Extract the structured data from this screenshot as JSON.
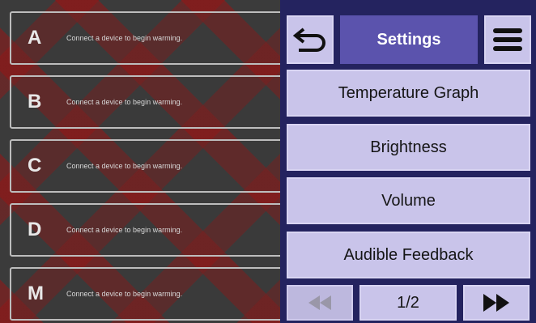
{
  "devices": [
    {
      "letter": "A",
      "message": "Connect a device to begin warming."
    },
    {
      "letter": "B",
      "message": "Connect a device to begin warming."
    },
    {
      "letter": "C",
      "message": "Connect a device to begin warming."
    },
    {
      "letter": "D",
      "message": "Connect a device to begin warming."
    },
    {
      "letter": "M",
      "message": "Connect a device to begin warming."
    }
  ],
  "header": {
    "title": "Settings",
    "back_icon": "undo-arrow-icon",
    "menu_icon": "hamburger-menu-icon"
  },
  "menu": {
    "items": [
      {
        "label": "Temperature Graph"
      },
      {
        "label": "Brightness"
      },
      {
        "label": "Volume"
      },
      {
        "label": "Audible Feedback"
      }
    ]
  },
  "pager": {
    "current_page": 1,
    "total_pages": 2,
    "label": "1/2",
    "prev_icon": "rewind-icon",
    "next_icon": "fast-forward-icon",
    "prev_disabled": true
  },
  "colors": {
    "panel": "#24235f",
    "button": "#c9c4ea",
    "accent": "#5b53ad",
    "warning_stripes": "#961414"
  }
}
